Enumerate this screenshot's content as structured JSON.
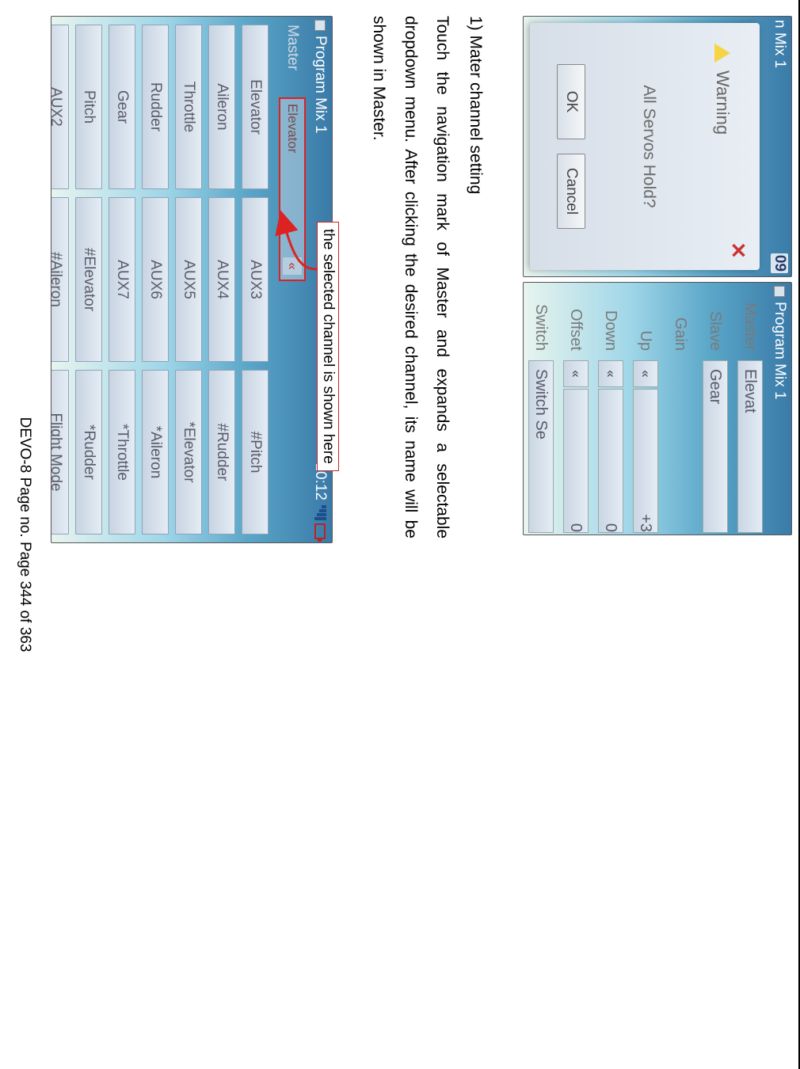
{
  "figure1": {
    "left": {
      "titlebar": {
        "left": "n Mix 1",
        "right_num": "09"
      },
      "modal": {
        "title": "Warning",
        "mid": "All Servos Hold?",
        "ok": "OK",
        "cancel": "Cancel"
      }
    },
    "right": {
      "titlebar": "Program Mix 1",
      "rows": [
        {
          "label": "Master",
          "value": "Elevat"
        },
        {
          "label": "Slave",
          "value": "Gear"
        },
        {
          "label": "Gain"
        },
        {
          "label": "Up",
          "stepL": "«",
          "value": "+3"
        },
        {
          "label": "Down",
          "stepL": "«",
          "value": "0"
        },
        {
          "label": "Offset",
          "stepL": "«",
          "value": "0"
        },
        {
          "label": "Switch",
          "value": "Switch Se"
        }
      ]
    }
  },
  "text": {
    "lead": "1)  Mater channel setting",
    "para": "Touch the navigation mark of Master and expands a selectable dropdown menu. After clicking the desired channel, its name will be shown in Master."
  },
  "figure2": {
    "callout": "the selected channel is shown here",
    "titlebar": {
      "left": "Program Mix 1",
      "time": "10:12"
    },
    "master_label": "Master",
    "master_selected": "Elevator",
    "cells": [
      "Elevator",
      "AUX3",
      "#Pitch",
      "Aileron",
      "AUX4",
      "#Rudder",
      "Throttle",
      "AUX5",
      "*Elevator",
      "Rudder",
      "AUX6",
      "*Aileron",
      "Gear",
      "AUX7",
      "*Throttle",
      "Pitch",
      "#Elevator",
      "*Rudder",
      "AUX2",
      "#Aileron",
      "Flight Mode"
    ]
  },
  "footer": "DEVO-8      Page no. Page 344 of 363"
}
